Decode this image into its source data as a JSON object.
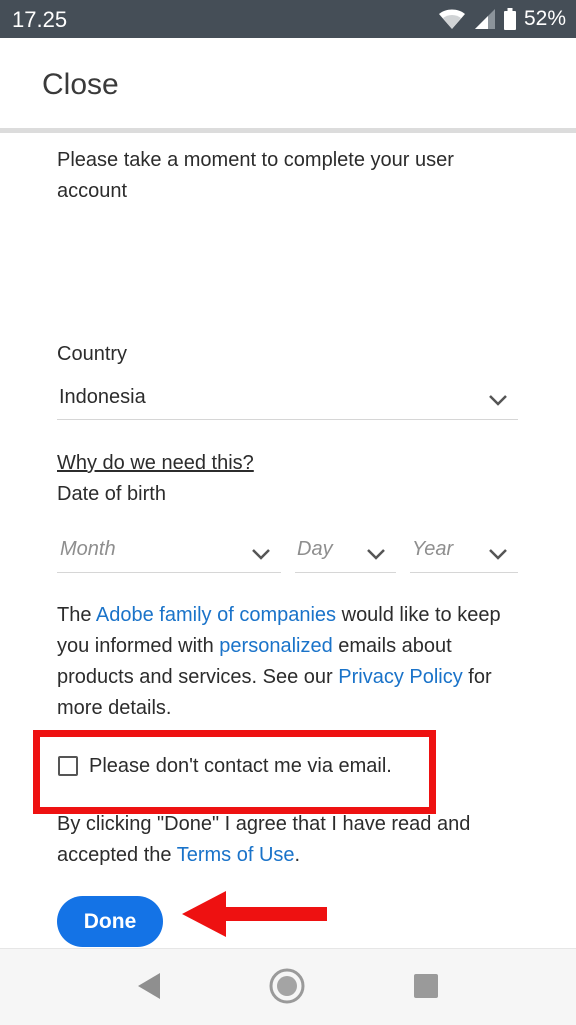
{
  "status_bar": {
    "time": "17.25",
    "battery_percent": "52%",
    "icons": [
      "wifi-icon",
      "signal-icon",
      "battery-icon"
    ]
  },
  "appbar": {
    "close_label": "Close"
  },
  "form": {
    "intro": "Please take a moment to complete your user account",
    "country_label": "Country",
    "country_value": "Indonesia",
    "why_link": "Why do we need this?",
    "dob_label": "Date of birth",
    "month_placeholder": "Month",
    "day_placeholder": "Day",
    "year_placeholder": "Year",
    "marketing": {
      "t1": "The ",
      "link1": "Adobe family of companies",
      "t2": " would like to keep you informed with ",
      "link2": "personalized",
      "t3": " emails about products and services. See our ",
      "link3": "Privacy Policy",
      "t4": " for more details."
    },
    "checkbox_label": "Please don't contact me via email.",
    "checkbox_checked": false,
    "terms": {
      "t1": "By clicking \"Done\" I agree that I have read and accepted the ",
      "link": "Terms of Use",
      "t2": "."
    },
    "done_label": "Done"
  },
  "colors": {
    "accent": "#1473e6",
    "link": "#1a73c9",
    "highlight": "#ee1111",
    "status_bar": "#454e57"
  },
  "nav_bar": {
    "buttons": [
      "back-icon",
      "home-icon",
      "recents-icon"
    ]
  }
}
